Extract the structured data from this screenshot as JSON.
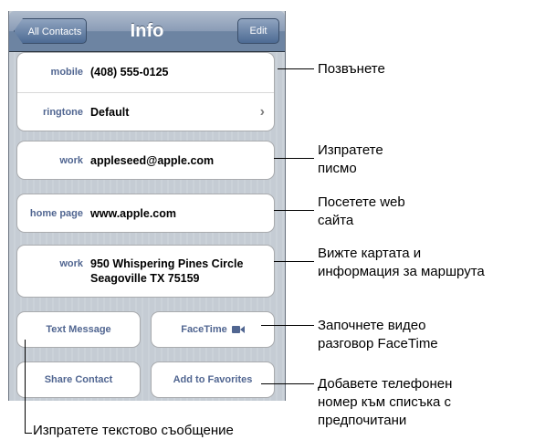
{
  "nav": {
    "back_label": "All Contacts",
    "title": "Info",
    "edit_label": "Edit"
  },
  "contact": {
    "phone": {
      "label": "mobile",
      "value": "(408) 555-0125"
    },
    "ringtone": {
      "label": "ringtone",
      "value": "Default"
    },
    "email": {
      "label": "work",
      "value": "appleseed@apple.com"
    },
    "homepage": {
      "label": "home page",
      "value": "www.apple.com"
    },
    "address": {
      "label": "work",
      "line1": "950 Whispering Pines Circle",
      "line2": "Seagoville TX 75159"
    }
  },
  "buttons": {
    "text_message": "Text Message",
    "facetime": "FaceTime",
    "share_contact": "Share Contact",
    "add_favorites": "Add to Favorites"
  },
  "callouts": {
    "call": "Позвънете",
    "email_line1": "Изпратете",
    "email_line2": "писмо",
    "web_line1": "Посетете web",
    "web_line2": "сайта",
    "map_line1": "Вижте картата и",
    "map_line2": "информация за  маршрута",
    "facetime_line1": "Започнете видео",
    "facetime_line2": "разговор FaceTime",
    "fav_line1": "Добавете телефонен",
    "fav_line2": "номер към списъка с",
    "fav_line3": "предпочитани",
    "sms": "Изпратете текстово съобщение"
  }
}
